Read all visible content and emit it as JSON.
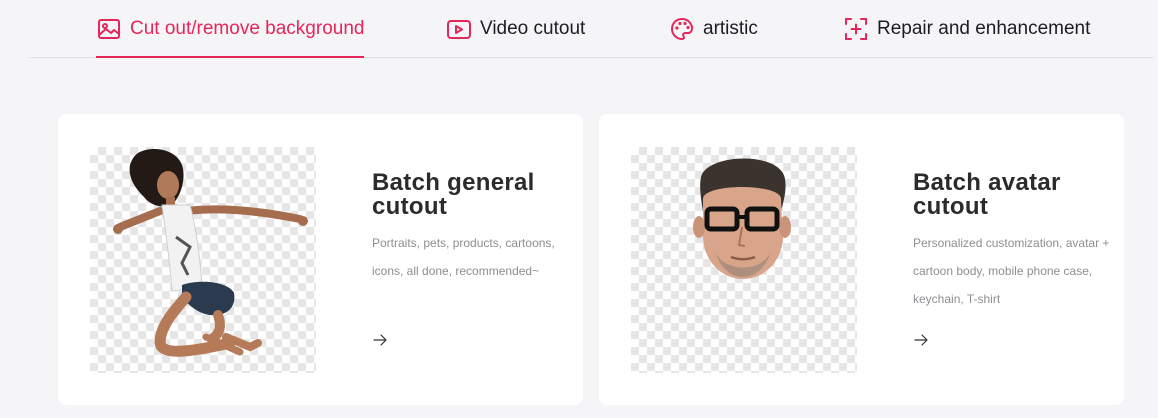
{
  "tabs": [
    {
      "label": "Cut out/remove background",
      "icon": "image-icon",
      "active": true
    },
    {
      "label": "Video cutout",
      "icon": "video-icon",
      "active": false
    },
    {
      "label": "artistic",
      "icon": "palette-icon",
      "active": false
    },
    {
      "label": "Repair and enhancement",
      "icon": "enhance-frame-icon",
      "active": false
    }
  ],
  "colors": {
    "accent": "#e5265a",
    "text": "#1d1d1f",
    "background": "#f5f5f7"
  },
  "cards": [
    {
      "title": "Batch general cutout",
      "description": "Portraits, pets, products, cartoons, icons, all done, recommended~",
      "image": "jumping-woman-cutout",
      "arrow_icon": "arrow-right-icon"
    },
    {
      "title": "Batch avatar cutout",
      "description": "Personalized customization, avatar + cartoon body, mobile phone case, keychain, T-shirt",
      "image": "man-head-cutout",
      "arrow_icon": "arrow-right-icon"
    }
  ]
}
